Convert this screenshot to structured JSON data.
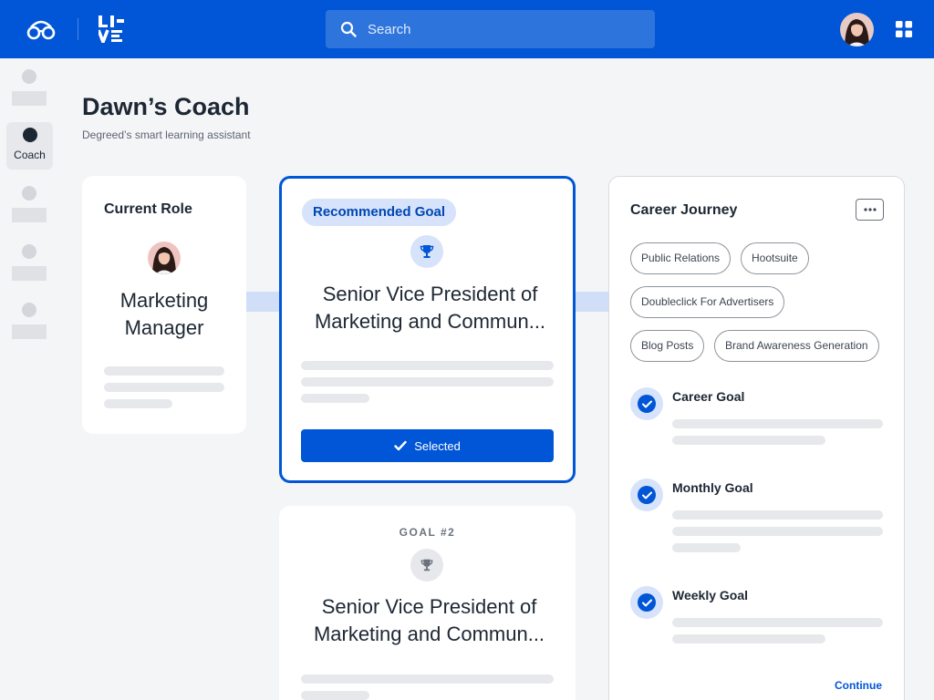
{
  "header": {
    "search_placeholder": "Search"
  },
  "nav": {
    "active_label": "Coach"
  },
  "page": {
    "title": "Dawn’s Coach",
    "subtitle": "Degreed’s smart learning assistant"
  },
  "current_role": {
    "heading": "Current Role",
    "title": "Marketing Manager"
  },
  "recommended_goal": {
    "badge": "Recommended Goal",
    "title": "Senior Vice President of Marketing and Commun...",
    "button_label": "Selected"
  },
  "goal_2": {
    "label": "GOAL #2",
    "title": "Senior Vice President of Marketing and Commun..."
  },
  "career_journey": {
    "heading": "Career Journey",
    "tags": [
      "Public Relations",
      "Hootsuite",
      "Doubleclick For Advertisers",
      "Blog Posts",
      "Brand Awareness Generation"
    ],
    "goals": [
      "Career Goal",
      "Monthly Goal",
      "Weekly Goal"
    ],
    "continue_label": "Continue"
  },
  "colors": {
    "brand_blue": "#0056d6",
    "badge_bg": "#d6e3fa",
    "connector": "#d0def7"
  }
}
